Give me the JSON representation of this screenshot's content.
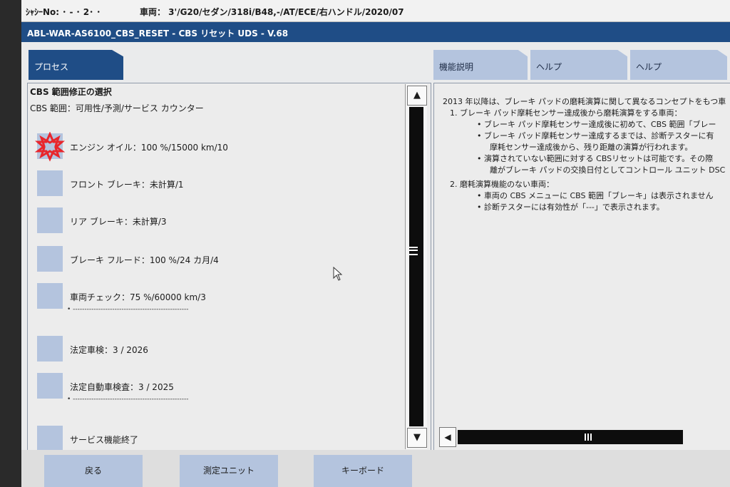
{
  "info_bar": {
    "chassis": "ｼｬｼｰNo:  ･ - ･ 2･ ･",
    "vehicle": "車両：   3'/G20/セダン/318i/B48,-/AT/ECE/右ハンドル/2020/07"
  },
  "title_bar": {
    "title": "ABL-WAR-AS6100_CBS_RESET - CBS リセット UDS - V.68"
  },
  "tabs": {
    "process": "プロセス",
    "function": "機能説明",
    "help1": "ヘルプ",
    "help2": "ヘルプ"
  },
  "left_panel": {
    "title": "CBS 範囲修正の選択",
    "subtitle": "CBS 範囲：可用性/予測/サービス カウンター",
    "items": [
      {
        "label": "エンジン オイル：100 %/15000 km/10",
        "icon": "warning-star-icon"
      },
      {
        "label": "フロント ブレーキ：未計算/1"
      },
      {
        "label": "リア ブレーキ：未計算/3"
      },
      {
        "label": "ブレーキ フルード：100 %/24 カ月/4"
      },
      {
        "label": "車両チェック：75 %/60000 km/3",
        "subline": "•  --------------------------------------------------"
      },
      {
        "label": "法定車検：3 / 2026"
      },
      {
        "label": "法定自動車検査：3 / 2025",
        "subline": "•  --------------------------------------------------"
      },
      {
        "label": "サービス機能終了"
      }
    ]
  },
  "right_panel": {
    "intro": "2013 年以降は、ブレーキ パッドの磨耗演算に関して異なるコンセプトをもつ車",
    "p1": "1.   ブレーキ パッド摩耗センサー達成後から磨耗演算をする車両：",
    "p1_b1": "•   ブレーキ パッド摩耗センサー達成後に初めて、CBS 範囲「ブレー",
    "p1_b2": "•   ブレーキ パッド摩耗センサー達成するまでは、診断テスターに有",
    "p1_b2_cont": "摩耗センサー達成後から、残り距離の演算が行われます。",
    "p1_b3": "•   演算されていない範囲に対する CBSリセットは可能です。その際",
    "p1_b3_cont": "離がブレーキ パッドの交換日付としてコントロール ユニット DSC",
    "p2": "2.   磨耗演算機能のない車両：",
    "p2_b1": "•   車両の CBS メニューに CBS 範囲「ブレーキ」は表示されません",
    "p2_b2": "•   診断テスターには有効性が「---」で表示されます。"
  },
  "scroll": {
    "up": "▲",
    "down": "▼",
    "left": "◀"
  },
  "bottom_buttons": {
    "back": "戻る",
    "measure_unit": "測定ユニット",
    "keyboard": "キーボード"
  },
  "colors": {
    "title_bar": "#1f4d86",
    "tab_inactive": "#b4c4de",
    "item_square": "#b4c4de",
    "warning_star": "#e8262c"
  }
}
